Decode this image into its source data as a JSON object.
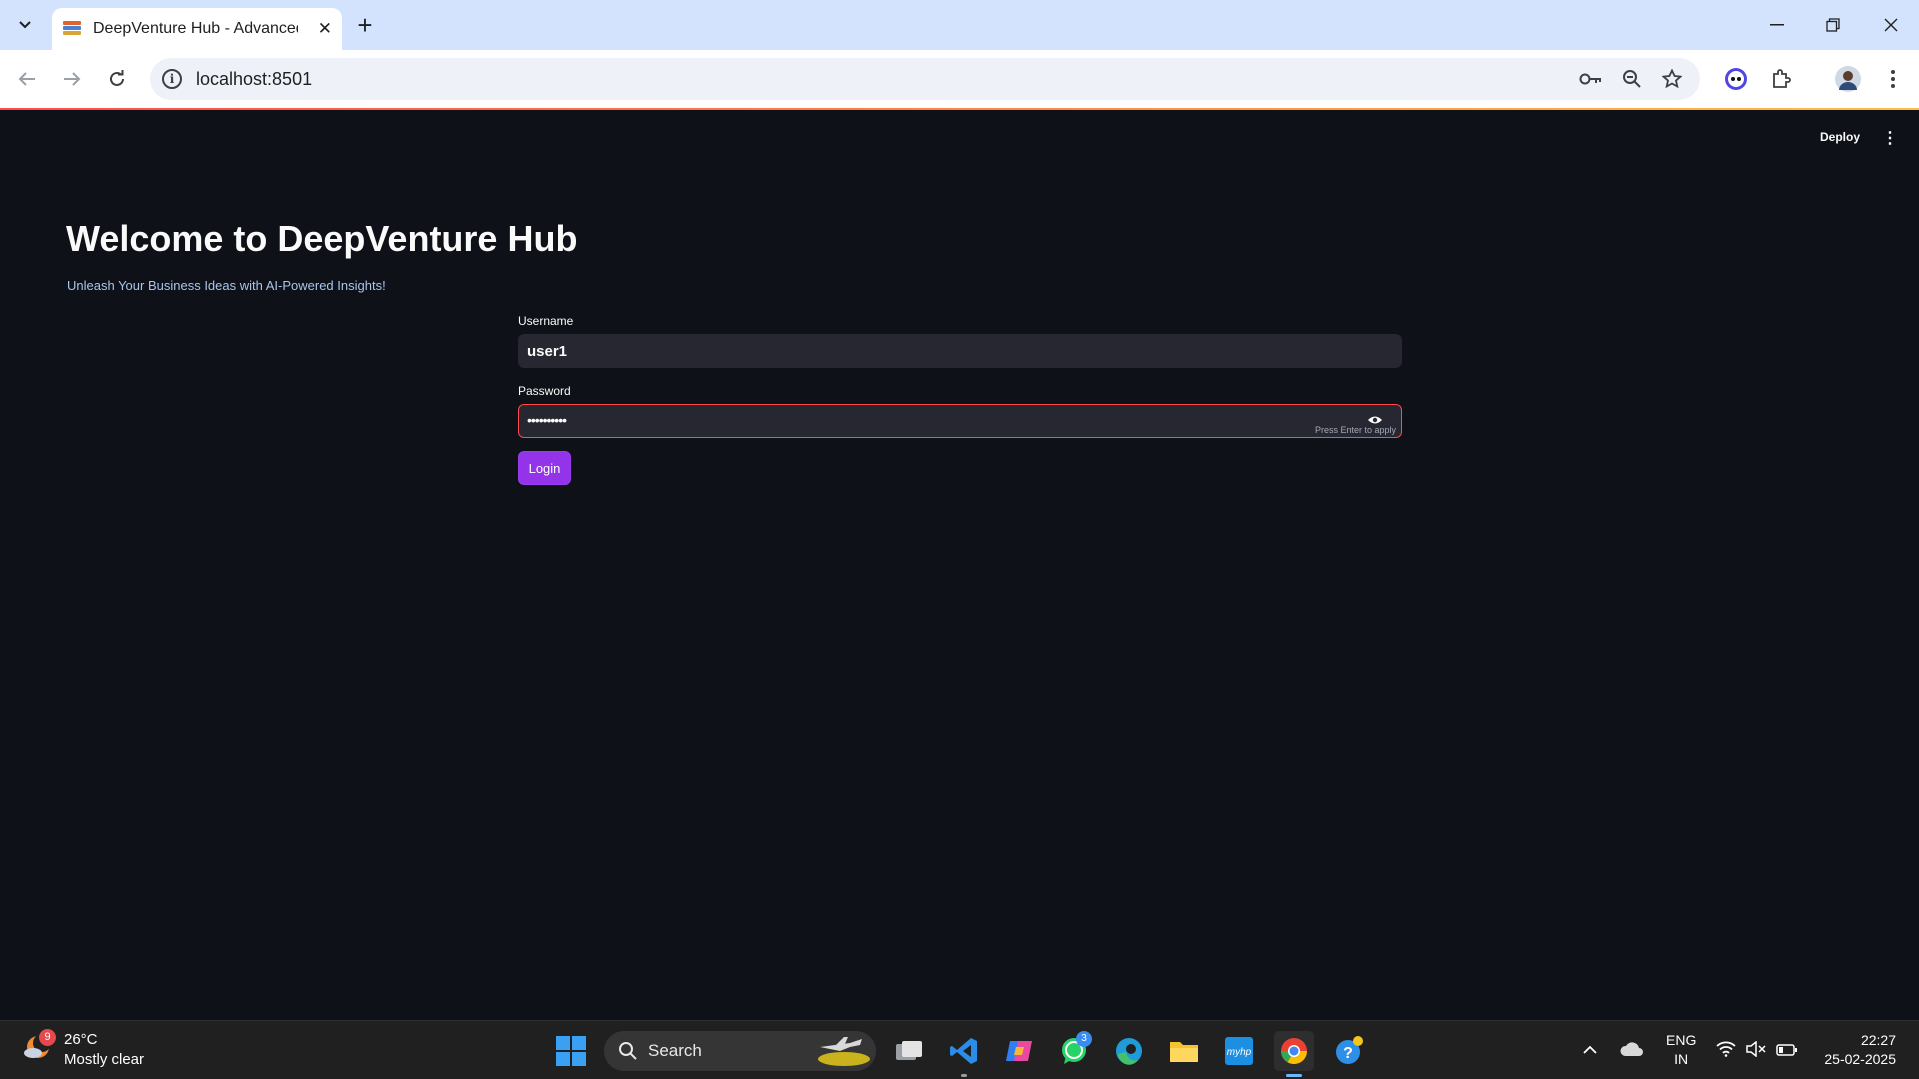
{
  "browser": {
    "tab_title": "DeepVenture Hub - Advanced N",
    "new_tab_symbol": "+",
    "url": "localhost:8501"
  },
  "app": {
    "deploy_label": "Deploy",
    "title": "Welcome to DeepVenture Hub",
    "subtitle": "Unleash Your Business Ideas with AI-Powered Insights!",
    "username_label": "Username",
    "username_value": "user1",
    "password_label": "Password",
    "password_masked": "••••••••••",
    "password_hint": "Press Enter to apply",
    "login_label": "Login"
  },
  "taskbar": {
    "weather_temp": "26°C",
    "weather_desc": "Mostly clear",
    "weather_badge": "9",
    "search_placeholder": "Search",
    "whatsapp_badge": "3",
    "lang_line1": "ENG",
    "lang_line2": "IN",
    "time": "22:27",
    "date": "25-02-2025"
  },
  "colors": {
    "app_bg": "#0e1117",
    "accent_button": "#9333ea",
    "focus_border": "#ff4b4b",
    "input_bg": "#262730",
    "subtitle": "#a9c5ec"
  }
}
